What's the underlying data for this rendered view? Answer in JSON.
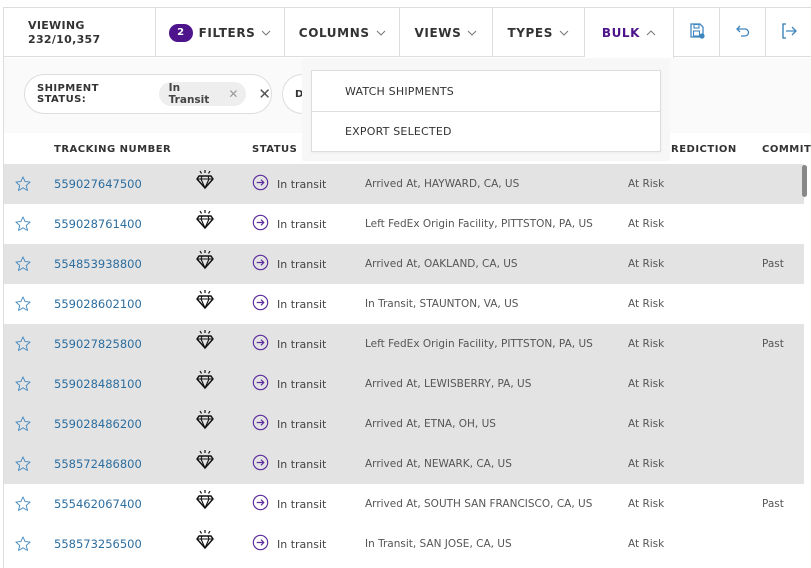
{
  "toolbar": {
    "viewing_label": "VIEWING",
    "viewing_count": "232/10,357",
    "filters_badge": "2",
    "filters_label": "FILTERS",
    "columns_label": "COLUMNS",
    "views_label": "VIEWS",
    "types_label": "TYPES",
    "bulk_label": "BULK",
    "icons": [
      "save-icon",
      "undo-icon",
      "exit-icon"
    ]
  },
  "colors": {
    "brand_purple": "#4d148c",
    "link_blue": "#2d6ea0",
    "row_grey": "#e3e3e3"
  },
  "filter_chips": [
    {
      "label": "SHIPMENT STATUS:",
      "value": "In Transit"
    },
    {
      "label": "D",
      "value": ""
    }
  ],
  "bulk_menu": {
    "items": [
      "WATCH SHIPMENTS",
      "EXPORT SELECTED"
    ]
  },
  "table": {
    "headers": {
      "tracking": "TRACKING NUMBER",
      "status": "STATUS",
      "prediction": "REDICTION",
      "commit": "COMMIT"
    },
    "rows": [
      {
        "tracking": "559027647500",
        "status": "In transit",
        "event": "Arrived At, HAYWARD, CA, US",
        "prediction": "At Risk",
        "commit": "",
        "shade": "grey"
      },
      {
        "tracking": "559028761400",
        "status": "In transit",
        "event": "Left FedEx Origin Facility, PITTSTON, PA, US",
        "prediction": "At Risk",
        "commit": "",
        "shade": "white"
      },
      {
        "tracking": "554853938800",
        "status": "In transit",
        "event": "Arrived At, OAKLAND, CA, US",
        "prediction": "At Risk",
        "commit": "Past",
        "shade": "grey"
      },
      {
        "tracking": "559028602100",
        "status": "In transit",
        "event": "In Transit, STAUNTON, VA, US",
        "prediction": "At Risk",
        "commit": "",
        "shade": "white"
      },
      {
        "tracking": "559027825800",
        "status": "In transit",
        "event": "Left FedEx Origin Facility, PITTSTON, PA, US",
        "prediction": "At Risk",
        "commit": "Past",
        "shade": "grey"
      },
      {
        "tracking": "559028488100",
        "status": "In transit",
        "event": "Arrived At, LEWISBERRY, PA, US",
        "prediction": "At Risk",
        "commit": "",
        "shade": "grey"
      },
      {
        "tracking": "559028486200",
        "status": "In transit",
        "event": "Arrived At, ETNA, OH, US",
        "prediction": "At Risk",
        "commit": "",
        "shade": "grey"
      },
      {
        "tracking": "558572486800",
        "status": "In transit",
        "event": "Arrived At, NEWARK, CA, US",
        "prediction": "At Risk",
        "commit": "",
        "shade": "grey"
      },
      {
        "tracking": "555462067400",
        "status": "In transit",
        "event": "Arrived At, SOUTH SAN FRANCISCO, CA, US",
        "prediction": "At Risk",
        "commit": "Past",
        "shade": "white"
      },
      {
        "tracking": "558573256500",
        "status": "In transit",
        "event": "In Transit, SAN JOSE, CA, US",
        "prediction": "At Risk",
        "commit": "",
        "shade": "white"
      }
    ]
  }
}
